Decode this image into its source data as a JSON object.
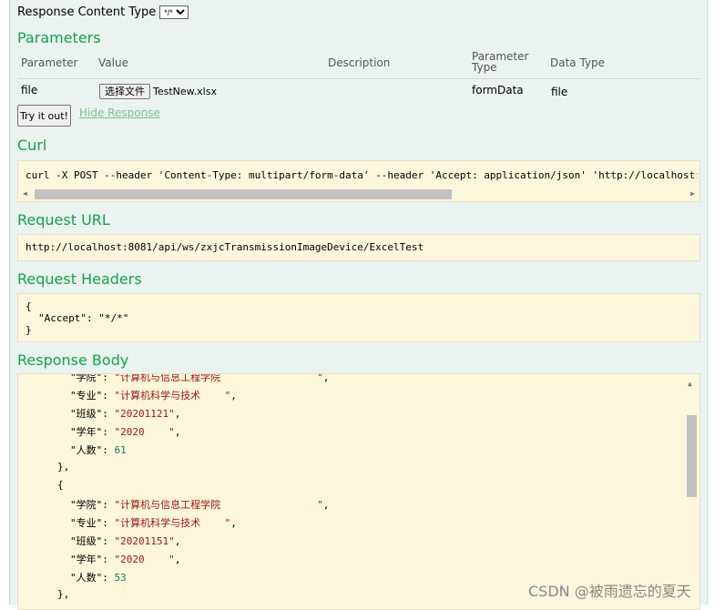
{
  "response_content_type": {
    "label": "Response Content Type",
    "selected": "*/*"
  },
  "parameters": {
    "heading": "Parameters",
    "columns": {
      "parameter": "Parameter",
      "value": "Value",
      "description": "Description",
      "parameter_type_1": "Parameter",
      "parameter_type_2": "Type",
      "data_type": "Data Type"
    },
    "row": {
      "name": "file",
      "choose_file": "选择文件",
      "file_name": "TestNew.xlsx",
      "param_type": "formData",
      "data_type": "file"
    }
  },
  "actions": {
    "try_it_out": "Try it out!",
    "hide_response": "Hide Response"
  },
  "curl": {
    "heading": "Curl",
    "command": "curl -X POST --header 'Content-Type: multipart/form-data' --header 'Accept: application/json' 'http://localhost:8081/api/ws/zxjcTransmissionImageDevice/ExcelTest'"
  },
  "request_url": {
    "heading": "Request URL",
    "url": "http://localhost:8081/api/ws/zxjcTransmissionImageDevice/ExcelTest"
  },
  "request_headers": {
    "heading": "Request Headers",
    "line1": "{",
    "key": "\"Accept\"",
    "colon": ": ",
    "value": "\"*/*\"",
    "line3": "}"
  },
  "response_body": {
    "heading": "Response Body",
    "lines": [
      {
        "k": "\"学院\"",
        "v": "\"计算机与信息工程学院                \"",
        "t": "s",
        "p": ","
      },
      {
        "k": "\"专业\"",
        "v": "\"计算机科学与技术    \"",
        "t": "s",
        "p": ","
      },
      {
        "k": "\"班级\"",
        "v": "\"20201121\"",
        "t": "s",
        "p": ","
      },
      {
        "k": "\"学年\"",
        "v": "\"2020    \"",
        "t": "s",
        "p": ","
      },
      {
        "k": "\"人数\"",
        "v": "61",
        "t": "n",
        "p": ""
      },
      {
        "brace": "},"
      },
      {
        "brace": "{"
      },
      {
        "k": "\"学院\"",
        "v": "\"计算机与信息工程学院                \"",
        "t": "s",
        "p": ","
      },
      {
        "k": "\"专业\"",
        "v": "\"计算机科学与技术    \"",
        "t": "s",
        "p": ","
      },
      {
        "k": "\"班级\"",
        "v": "\"20201151\"",
        "t": "s",
        "p": ","
      },
      {
        "k": "\"学年\"",
        "v": "\"2020    \"",
        "t": "s",
        "p": ","
      },
      {
        "k": "\"人数\"",
        "v": "53",
        "t": "n",
        "p": ""
      },
      {
        "brace": "},"
      }
    ]
  },
  "watermark": "CSDN @被雨遗忘的夏天"
}
